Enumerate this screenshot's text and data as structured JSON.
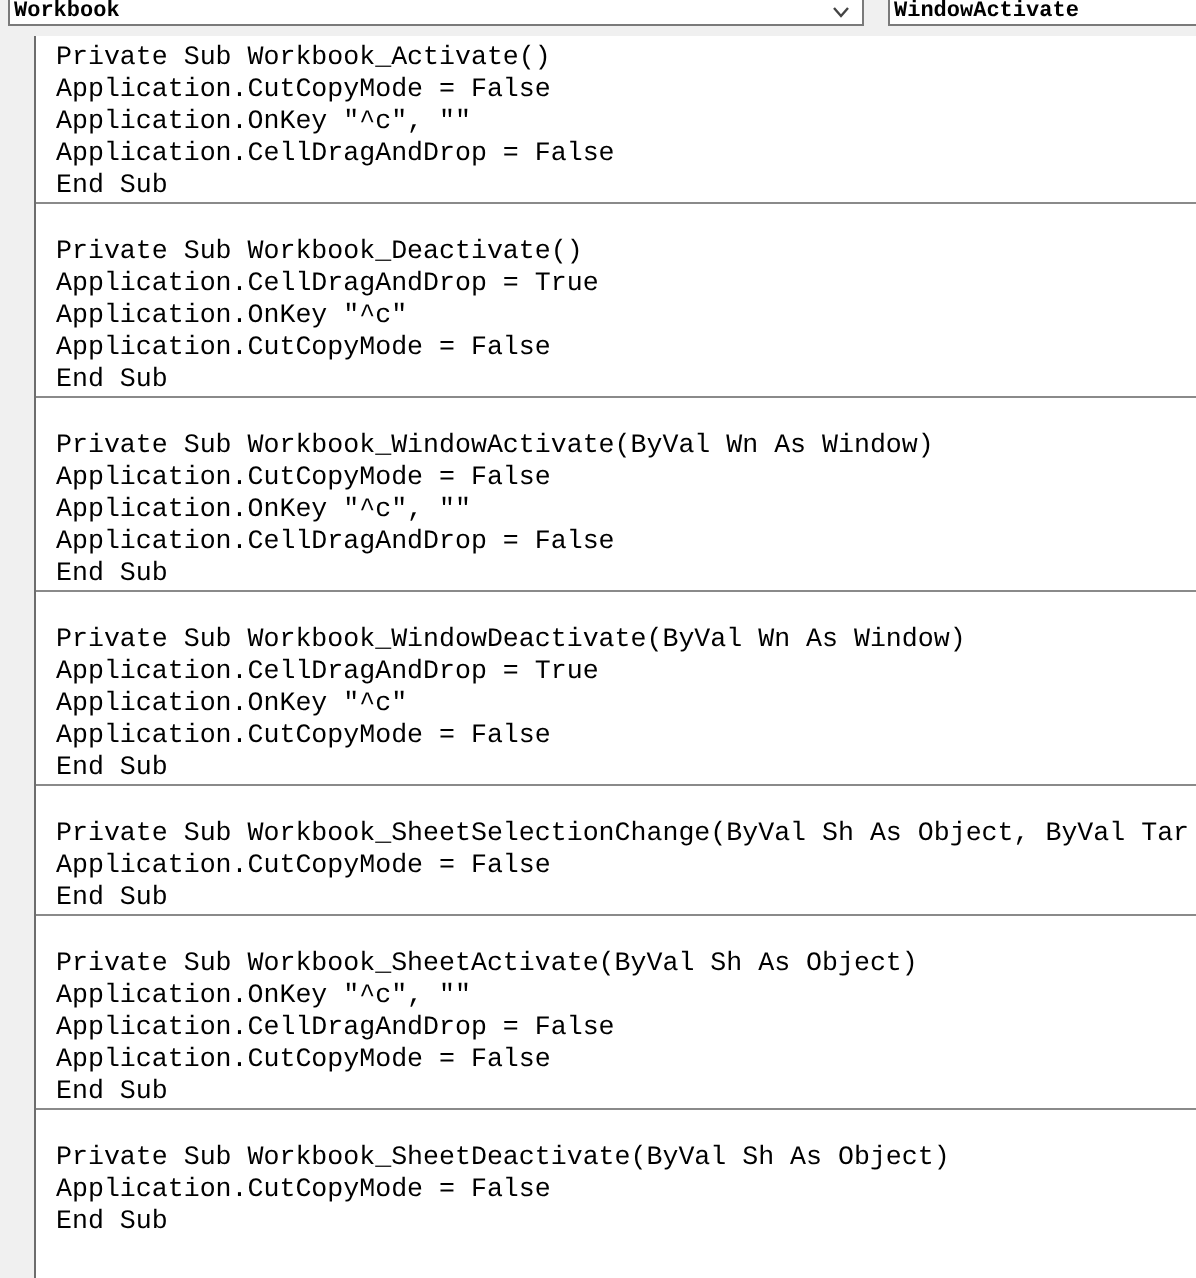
{
  "object_dropdown": {
    "value": "Workbook"
  },
  "procedure_dropdown": {
    "value": "WindowActivate"
  },
  "procedures": [
    {
      "lines": [
        "Private Sub Workbook_Activate()",
        "Application.CutCopyMode = False",
        "Application.OnKey \"^c\", \"\"",
        "Application.CellDragAndDrop = False",
        "End Sub"
      ]
    },
    {
      "lines": [
        "Private Sub Workbook_Deactivate()",
        "Application.CellDragAndDrop = True",
        "Application.OnKey \"^c\"",
        "Application.CutCopyMode = False",
        "End Sub"
      ]
    },
    {
      "lines": [
        "Private Sub Workbook_WindowActivate(ByVal Wn As Window)",
        "Application.CutCopyMode = False",
        "Application.OnKey \"^c\", \"\"",
        "Application.CellDragAndDrop = False",
        "End Sub"
      ]
    },
    {
      "lines": [
        "Private Sub Workbook_WindowDeactivate(ByVal Wn As Window)",
        "Application.CellDragAndDrop = True",
        "Application.OnKey \"^c\"",
        "Application.CutCopyMode = False",
        "End Sub"
      ]
    },
    {
      "lines": [
        "Private Sub Workbook_SheetSelectionChange(ByVal Sh As Object, ByVal Tar",
        "Application.CutCopyMode = False",
        "End Sub"
      ]
    },
    {
      "lines": [
        "Private Sub Workbook_SheetActivate(ByVal Sh As Object)",
        "Application.OnKey \"^c\", \"\"",
        "Application.CellDragAndDrop = False",
        "Application.CutCopyMode = False",
        "End Sub"
      ]
    },
    {
      "lines": [
        "Private Sub Workbook_SheetDeactivate(ByVal Sh As Object)",
        "Application.CutCopyMode = False",
        "End Sub"
      ]
    }
  ]
}
